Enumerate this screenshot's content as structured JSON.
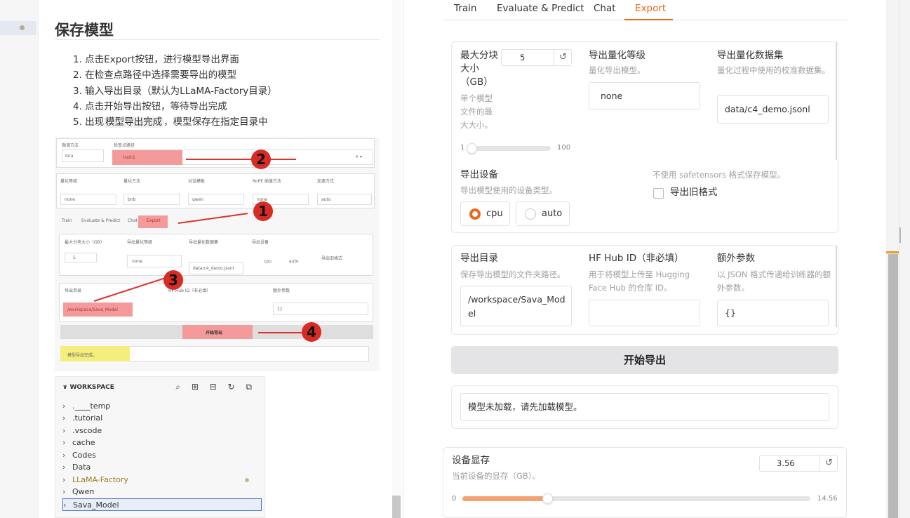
{
  "doc": {
    "heading": "保存模型",
    "steps": [
      "1. 点击Export按钮，进行模型导出界面",
      "2. 在检查点路径中选择需要导出的模型",
      "3. 输入导出目录（默认为LLaMA-Factory目录）",
      "4. 点击开始导出按钮，等待导出完成"
    ],
    "step5_prefix": "5. 出现",
    "step5_highlight": "模型导出完成",
    "step5_suffix": "，模型保存在指定目录中",
    "shot": {
      "finetune_label": "微调方法",
      "finetune_value": "lora",
      "ckpt_label": "检查点路径",
      "ckpt_value": "train1",
      "clear": "× ▾",
      "quant_label": "量化等级",
      "quant_value": "none",
      "qmethod_label": "量化方法",
      "qmethod_value": "bnb",
      "template_label": "对话模板",
      "template_value": "qwen",
      "rope_label": "RoPE 插值方法",
      "rope_value": "none",
      "accel_label": "加速方式",
      "accel_value": "auto",
      "tabs": [
        "Train",
        "Evaluate & Predict",
        "Chat",
        "Export"
      ],
      "size_label": "最大分块大小（GB）",
      "size_value": "5",
      "eq_label": "导出量化等级",
      "eq_value": "none",
      "ed_label": "导出量化数据集",
      "ed_value": "data/c4_demo.jsonl",
      "dev_label": "导出设备",
      "dev_cpu": "cpu",
      "dev_auto": "auto",
      "legacy": "导出旧格式",
      "dir_label": "导出目录",
      "dir_value": "/workspace/Sava_Model",
      "hub_label": "HF Hub ID（非必填）",
      "extra_label": "额外参数",
      "extra_value": "{}",
      "start": "开始导出",
      "done": "模型导出完成。"
    },
    "badges": [
      "2",
      "1",
      "3",
      "4"
    ],
    "explorer": {
      "title": "WORKSPACE",
      "tools": "⌕ ⊞ ⊟ ↻ ⧉",
      "items": [
        ".____temp",
        ".tutorial",
        ".vscode",
        "cache",
        "Codes",
        "Data",
        "LLaMA-Factory",
        "Qwen",
        "Sava_Model"
      ]
    }
  },
  "app": {
    "tabs": [
      "Train",
      "Evaluate & Predict",
      "Chat",
      "Export"
    ],
    "active_tab": "Export",
    "accent": "#f0661d",
    "max_shard": {
      "label": "最大分块大小（GB）",
      "info": "单个模型文件的最大大小。",
      "value": "5",
      "reset": "↺",
      "min": "1",
      "max": "100",
      "fraction": 0.0
    },
    "export_quant_bit": {
      "label": "导出量化等级",
      "info": "量化导出模型。",
      "value": "none"
    },
    "export_quant_dataset": {
      "label": "导出量化数据集",
      "info": "量化过程中使用的校准数据集。",
      "value": "data/c4_demo.jsonl"
    },
    "export_device": {
      "label": "导出设备",
      "info": "导出模型使用的设备类型。",
      "options": [
        "cpu",
        "auto"
      ],
      "selected": "cpu"
    },
    "legacy": {
      "info": "不使用 safetensors 格式保存模型。",
      "label": "导出旧格式"
    },
    "export_dir": {
      "label": "导出目录",
      "info": "保存导出模型的文件夹路径。",
      "value_line1": "/workspace/Sava_Mod",
      "value_line2": "el"
    },
    "hub_id": {
      "label": "HF Hub ID（非必填）",
      "info": "用于将模型上传至 Hugging Face Hub 的仓库 ID。",
      "value": ""
    },
    "extra_args": {
      "label": "额外参数",
      "info": "以 JSON 格式传递给训练器的额外参数。",
      "value": "{}"
    },
    "start_button": "开始导出",
    "output": "模型未加载，请先加载模型。",
    "gpu_memory": {
      "label": "设备显存",
      "info": "当前设备的显存（GB）。",
      "value": "3.56",
      "reset": "↺",
      "min": "0",
      "max": "14.56",
      "fraction": 0.2445
    }
  }
}
